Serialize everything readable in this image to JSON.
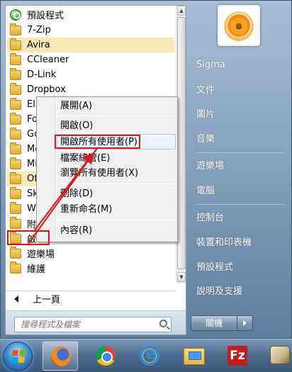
{
  "programs": [
    {
      "label": "預設程式",
      "icon": "default-programs-icon"
    },
    {
      "label": "7-Zip",
      "icon": "folder-icon"
    },
    {
      "label": "Avira",
      "icon": "folder-icon",
      "highlight": true
    },
    {
      "label": "CCleaner",
      "icon": "folder-icon"
    },
    {
      "label": "D-Link",
      "icon": "folder-icon"
    },
    {
      "label": "Dropbox",
      "icon": "folder-icon"
    },
    {
      "label": "Ela",
      "icon": "folder-icon"
    },
    {
      "label": "Fox",
      "icon": "folder-icon"
    },
    {
      "label": "Go",
      "icon": "folder-icon"
    },
    {
      "label": "Mo",
      "icon": "folder-icon"
    },
    {
      "label": "Mi",
      "icon": "folder-icon"
    },
    {
      "label": "Of",
      "icon": "folder-icon"
    },
    {
      "label": "Sky",
      "icon": "folder-icon"
    },
    {
      "label": "Wi",
      "icon": "folder-icon"
    },
    {
      "label": "附",
      "icon": "folder-icon"
    },
    {
      "label": "啟",
      "icon": "folder-icon"
    },
    {
      "label": "遊樂場",
      "icon": "folder-icon"
    },
    {
      "label": "維護",
      "icon": "folder-icon"
    }
  ],
  "back_label": "上一頁",
  "search_placeholder": "搜尋程式及檔案",
  "right_items": [
    "Sigma",
    "文件",
    "圖片",
    "音樂",
    "遊樂場",
    "電腦",
    "控制台",
    "裝置和印表機",
    "預設程式",
    "說明及支援"
  ],
  "shutdown_label": "關機",
  "context_menu": [
    {
      "label": "展開(A)"
    },
    {
      "label": "開啟(O)"
    },
    {
      "label": "開啟所有使用者(P)",
      "hover": true
    },
    {
      "label": "檔案總管(E)"
    },
    {
      "label": "瀏覽所有使用者(X)"
    },
    {
      "label": "刪除(D)"
    },
    {
      "label": "重新命名(M)"
    },
    {
      "label": "內容(R)"
    }
  ],
  "taskbar": [
    "start-orb",
    "firefox-icon",
    "chrome-icon",
    "internet-explorer-icon",
    "windows-explorer-icon",
    "filezilla-icon",
    "app-icon"
  ],
  "filezilla_glyph": "Fz",
  "annotation_color": "#e0141a"
}
